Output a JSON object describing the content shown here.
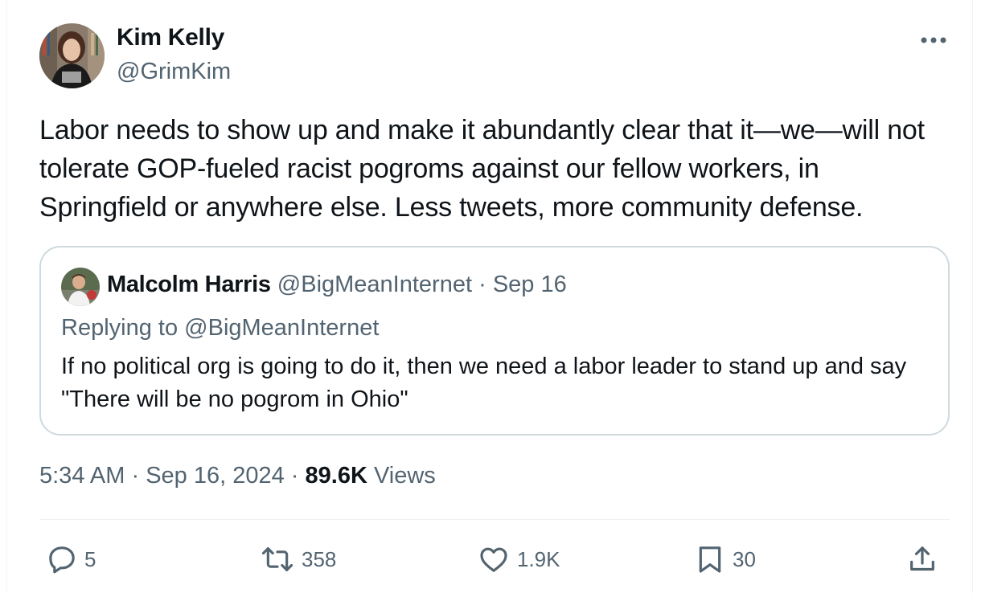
{
  "author": {
    "name": "Kim Kelly",
    "handle": "@GrimKim"
  },
  "tweet": {
    "text": "Labor needs to show up and make it abundantly clear that it—we—will not tolerate GOP-fueled racist pogroms against our fellow workers, in Springfield or anywhere else. Less tweets, more community defense."
  },
  "quoted": {
    "name": "Malcolm Harris",
    "handle": "@BigMeanInternet",
    "separator": " · ",
    "date": "Sep 16",
    "replying_prefix": "Replying to ",
    "replying_handle": "@BigMeanInternet",
    "text": "If no political org is going to do it, then we need a labor leader to stand up and say \"There will be no pogrom in Ohio\""
  },
  "meta": {
    "time": "5:34 AM",
    "separator": " · ",
    "date": "Sep 16, 2024",
    "views_count": "89.6K",
    "views_label": " Views"
  },
  "actions": {
    "replies": "5",
    "reposts": "358",
    "likes": "1.9K",
    "bookmarks": "30"
  },
  "icons": {
    "more": "more-icon",
    "reply": "reply-icon",
    "repost": "repost-icon",
    "like": "heart-icon",
    "bookmark": "bookmark-icon",
    "share": "share-icon"
  },
  "colors": {
    "text": "#0f1419",
    "secondary": "#536471",
    "border": "#cfd9de"
  }
}
